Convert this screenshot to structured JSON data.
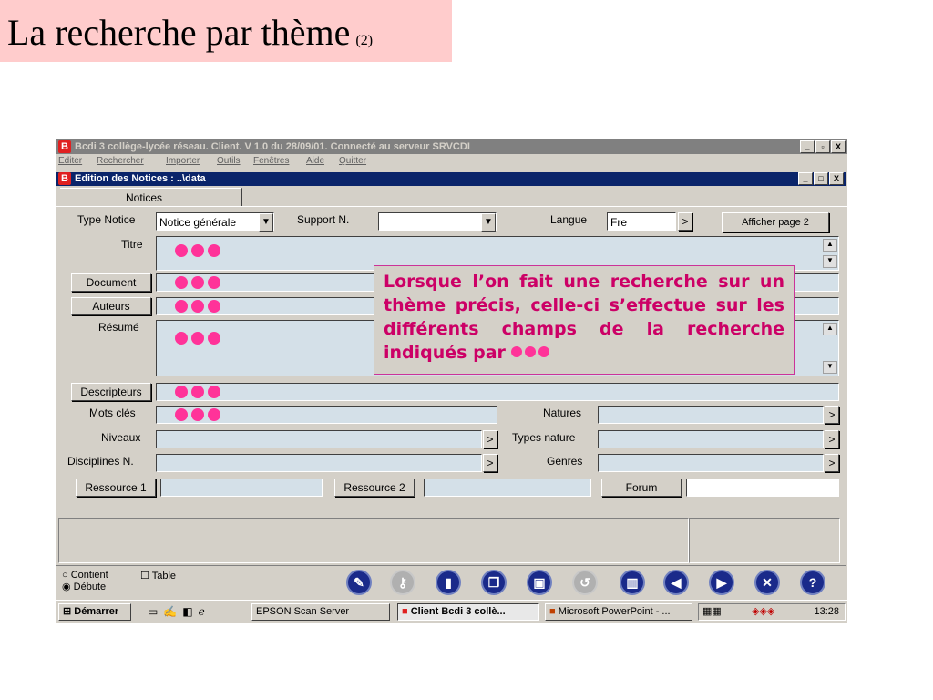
{
  "slide": {
    "title": "La recherche par thème",
    "subtitle": "(2)"
  },
  "window": {
    "app_icon": "B",
    "title": "Bcdi 3 collège-lycée réseau. Client. V 1.0 du 28/09/01. Connecté au serveur SRVCDI",
    "controls": [
      "_",
      "▫",
      "X"
    ]
  },
  "menu": [
    "Editer",
    "Rechercher",
    "Importer",
    "Outils",
    "Fenêtres",
    "Aide",
    "Quitter"
  ],
  "child_window": {
    "title": "Edition des Notices : ..\\data",
    "controls": [
      "_",
      "□",
      "X"
    ]
  },
  "tab": {
    "label": "Notices"
  },
  "form": {
    "type_notice_label": "Type Notice",
    "type_notice_value": "Notice générale",
    "support_label": "Support N.",
    "support_value": "",
    "langue_label": "Langue",
    "langue_value": "Fre",
    "afficher_button": "Afficher page 2",
    "titre_label": "Titre",
    "document_button": "Document",
    "auteurs_button": "Auteurs",
    "resume_label": "Résumé",
    "descripteurs_button": "Descripteurs",
    "mots_cles_label": "Mots clés",
    "natures_label": "Natures",
    "niveaux_label": "Niveaux",
    "types_nature_label": "Types nature",
    "disciplines_label": "Disciplines N.",
    "genres_label": "Genres",
    "ressource1_button": "Ressource 1",
    "ressource2_button": "Ressource 2",
    "forum_button": "Forum",
    "more_arrow": ">"
  },
  "callout": {
    "text": "Lorsque l’on fait une recherche sur un thème précis, celle-ci s’effectue sur les différents champs de la recherche indiqués par"
  },
  "search_mode": {
    "option_contient": "Contient",
    "option_debute": "Débute",
    "table_label": "Table"
  },
  "toolbar_icons": [
    "new-icon",
    "key-icon",
    "book-icon",
    "copy-icon",
    "save-icon",
    "undo-icon",
    "trash-icon",
    "previous-icon",
    "next-icon",
    "close-icon",
    "help-icon"
  ],
  "taskbar": {
    "start": "Démarrer",
    "tasks": [
      "EPSON Scan Server",
      "Client Bcdi 3 collè...",
      "Microsoft PowerPoint - ..."
    ],
    "clock": "13:28"
  },
  "colors": {
    "slide_title_bg": "#ffcccc",
    "highlight_dot": "#ff3399",
    "callout_text": "#cc0066",
    "active_title": "#0a246a"
  }
}
